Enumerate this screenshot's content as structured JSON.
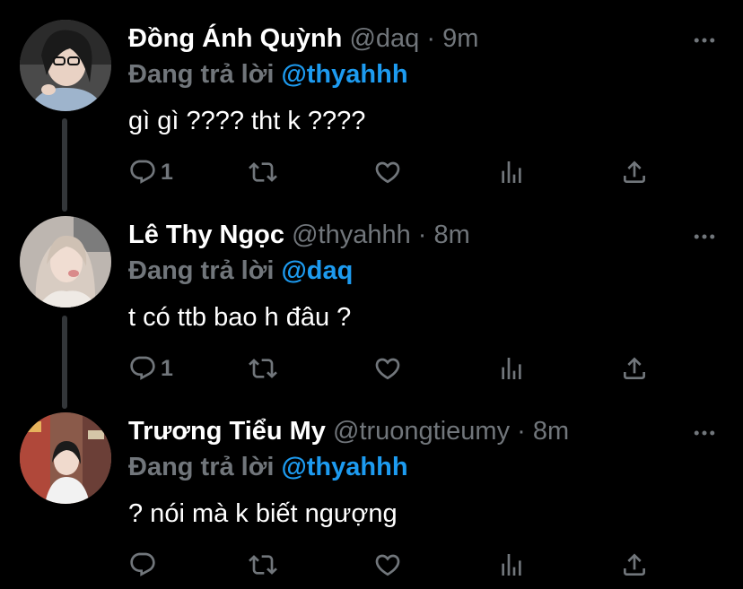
{
  "ui": {
    "muted_color": "#71767b",
    "mention_color": "#1d9bf0",
    "background": "#000000",
    "thread_line_color": "#333639"
  },
  "tweets": [
    {
      "name": "Đồng Ánh Quỳnh",
      "handle": "@daq",
      "dot": "·",
      "time": "9m",
      "reply_prefix": "Đang trả lời ",
      "reply_to": "@thyahhh",
      "text": "gì gì ???? tht k ????",
      "reply_count": "1"
    },
    {
      "name": "Lê Thy Ngọc",
      "handle": "@thyahhh",
      "dot": "·",
      "time": "8m",
      "reply_prefix": "Đang trả lời ",
      "reply_to": "@daq",
      "text": "t có ttb bao h đâu ?",
      "reply_count": "1"
    },
    {
      "name": "Trương Tiểu My",
      "handle": "@truongtieumy",
      "dot": "·",
      "time": "8m",
      "reply_prefix": "Đang trả lời ",
      "reply_to": "@thyahhh",
      "text": "? nói mà k biết ngượng",
      "reply_count": ""
    }
  ]
}
